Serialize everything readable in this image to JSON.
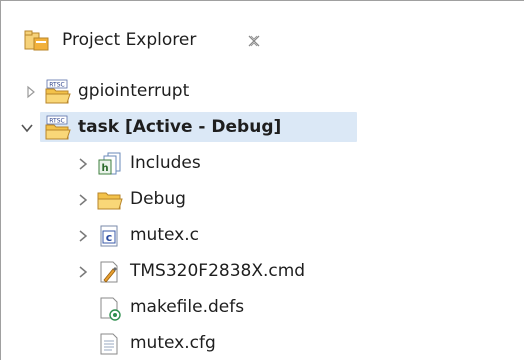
{
  "view": {
    "title": "Project Explorer",
    "close_glyph": "✕"
  },
  "tree": {
    "items": [
      {
        "label": "gpiointerrupt",
        "icon": "rtsc-project-icon",
        "expanded": false,
        "bold": false
      },
      {
        "label": "task  [Active - Debug]",
        "icon": "rtsc-project-icon",
        "expanded": true,
        "bold": true,
        "selected": true
      },
      {
        "label": "Includes",
        "icon": "includes-icon",
        "expanded": false,
        "bold": false
      },
      {
        "label": "Debug",
        "icon": "folder-icon",
        "expanded": false,
        "bold": false
      },
      {
        "label": "mutex.c",
        "icon": "c-file-icon",
        "expanded": false,
        "bold": false
      },
      {
        "label": "TMS320F2838X.cmd",
        "icon": "cmd-file-icon",
        "expanded": false,
        "bold": false
      },
      {
        "label": "makefile.defs",
        "icon": "makefile-icon",
        "bold": false
      },
      {
        "label": "mutex.cfg",
        "icon": "text-file-icon",
        "bold": false
      }
    ],
    "rtsc_badge": "RTSC",
    "c_badge": "c",
    "h_badge": "h"
  },
  "colors": {
    "selection": "#dbe8f6",
    "folder": "#f0c24e",
    "folder_dark": "#c98d12",
    "twisty": "#7a7a7a"
  }
}
